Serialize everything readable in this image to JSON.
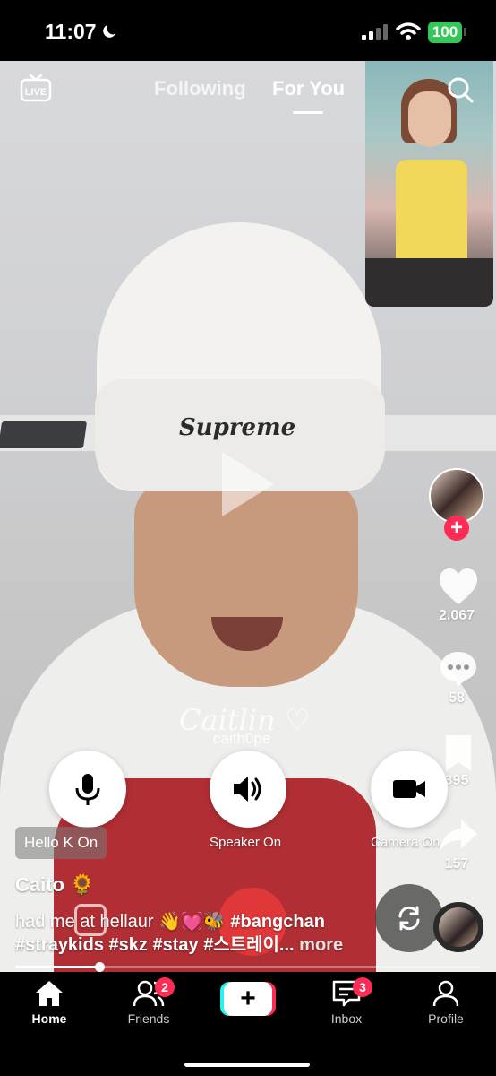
{
  "status_bar": {
    "time": "11:07",
    "battery": "100"
  },
  "top_bar": {
    "live_label": "LIVE",
    "tabs": [
      {
        "label": "Following"
      },
      {
        "label": "For You"
      }
    ],
    "active_tab": "For You"
  },
  "video": {
    "beanie_text": "Supreme",
    "watermark": "Caitlin ♡",
    "watermark_user": "caith0pe"
  },
  "rail": {
    "likes": "2,067",
    "comments": "58",
    "bookmarks": "395",
    "shares": "157"
  },
  "call_controls": [
    {
      "label": ""
    },
    {
      "label": "Speaker On"
    },
    {
      "label": "Camera On"
    }
  ],
  "hello_chip": "Hello K On",
  "post": {
    "author": "Caito 🌻",
    "caption_text": "had me at hellaur 👋💓🐝 ",
    "tags": [
      "#bangchan",
      "#straykids",
      "#skz",
      "#stay",
      "#스트레이..."
    ],
    "more": "more"
  },
  "progress": {
    "fraction": 0.18
  },
  "bottom_nav": {
    "items": [
      {
        "label": "Home",
        "active": true
      },
      {
        "label": "Friends",
        "badge": "2"
      },
      {
        "label": ""
      },
      {
        "label": "Inbox",
        "badge": "3"
      },
      {
        "label": "Profile"
      }
    ]
  },
  "colors": {
    "accent": "#fe2c55",
    "cyan": "#25f4ee",
    "battery": "#34c759"
  },
  "icons": [
    "moon-icon",
    "signal-icon",
    "wifi-icon",
    "live-tv-icon",
    "search-icon",
    "heart-icon",
    "comment-icon",
    "bookmark-icon",
    "share-icon",
    "microphone-icon",
    "speaker-icon",
    "video-camera-icon",
    "flip-camera-icon",
    "home-icon",
    "friends-icon",
    "plus-icon",
    "inbox-icon",
    "profile-icon"
  ]
}
